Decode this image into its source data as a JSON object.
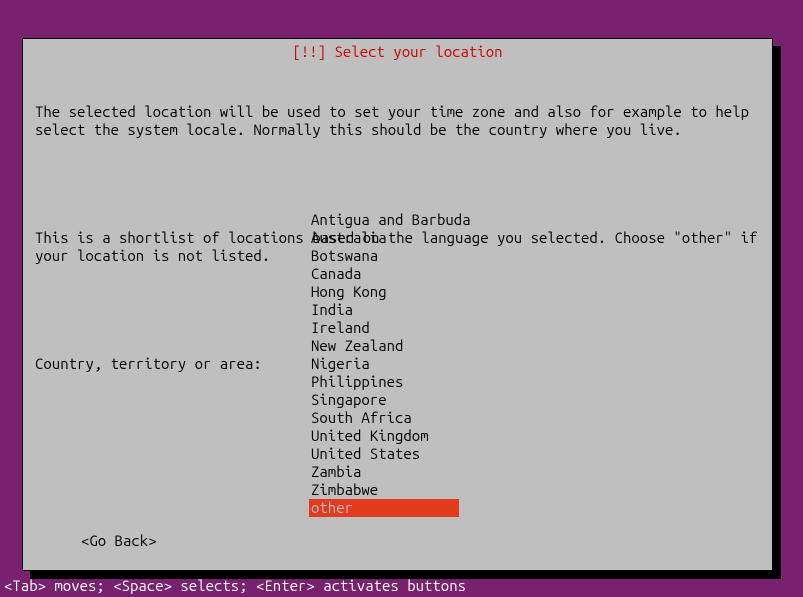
{
  "title_prefix": "[!!] ",
  "title": "Select your location",
  "para1": "The selected location will be used to set your time zone and also for example to help select the system locale. Normally this should be the country where you live.",
  "para2": "This is a shortlist of locations based on the language you selected. Choose \"other\" if your location is not listed.",
  "prompt": "Country, territory or area:",
  "locations": [
    "Antigua and Barbuda",
    "Australia",
    "Botswana",
    "Canada",
    "Hong Kong",
    "India",
    "Ireland",
    "New Zealand",
    "Nigeria",
    "Philippines",
    "Singapore",
    "South Africa",
    "United Kingdom",
    "United States",
    "Zambia",
    "Zimbabwe",
    "other"
  ],
  "selected_index": 16,
  "go_back": "<Go Back>",
  "help_text": "<Tab> moves; <Space> selects; <Enter> activates buttons"
}
